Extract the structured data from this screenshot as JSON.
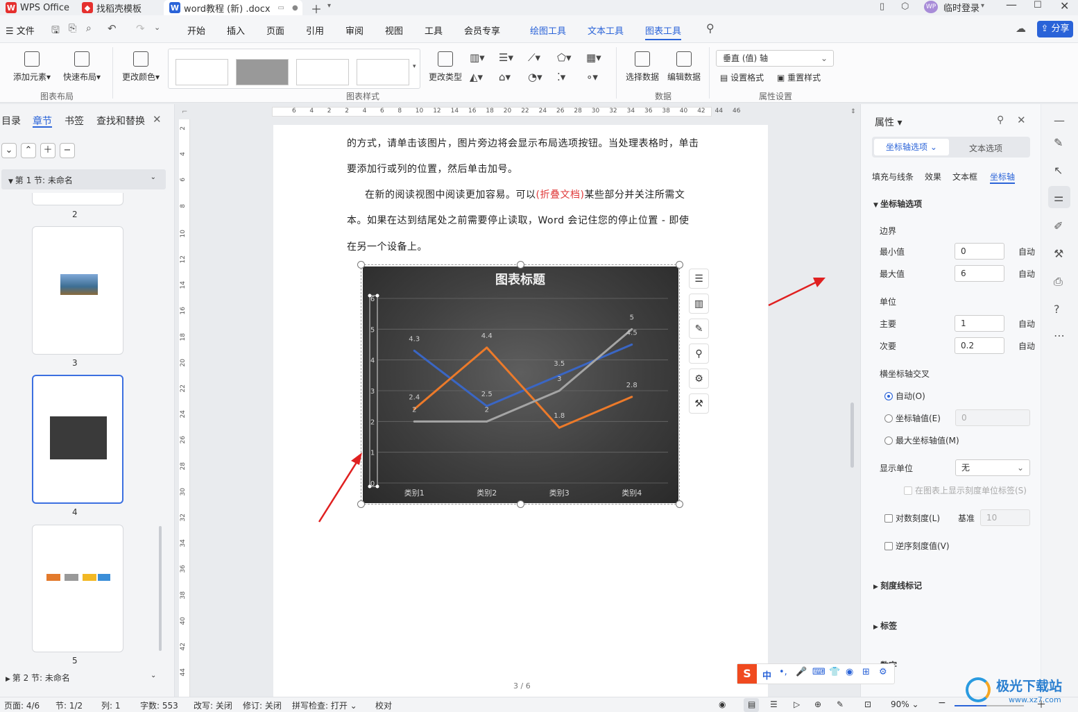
{
  "titlebar": {
    "tabs": [
      {
        "label": "WPS Office",
        "logo": "W",
        "color": "#e5302e"
      },
      {
        "label": "找稻壳模板",
        "logo": "◆",
        "color": "#e5302e"
      },
      {
        "label": "word教程 (新) .docx",
        "logo": "W",
        "color": "#2a63d8"
      }
    ],
    "user": "临时登录"
  },
  "menubar": {
    "file": "文件",
    "items": [
      "开始",
      "插入",
      "页面",
      "引用",
      "审阅",
      "视图",
      "工具",
      "会员专享"
    ],
    "tool_tabs": [
      "绘图工具",
      "文本工具",
      "图表工具"
    ],
    "share": "分享"
  },
  "ribbon": {
    "add_element": "添加元素",
    "quick_layout": "快速布局",
    "group_layout": "图表布局",
    "change_color": "更改颜色",
    "group_style": "图表样式",
    "change_type": "更改类型",
    "select_data": "选择数据",
    "edit_data": "编辑数据",
    "group_data": "数据",
    "axis_dropdown": "垂直 (值) 轴",
    "set_format": "设置格式",
    "reset_style": "重置样式",
    "group_props": "属性设置"
  },
  "leftpane": {
    "tabs": [
      "目录",
      "章节",
      "书签",
      "查找和替换"
    ],
    "section1": "第 1 节: 未命名",
    "section2": "第 2 节: 未命名",
    "pages": [
      "2",
      "3",
      "4",
      "5"
    ]
  },
  "ruler": {
    "h_ticks": [
      "6",
      "4",
      "2",
      "2",
      "4",
      "6",
      "8",
      "10",
      "12",
      "14",
      "16",
      "18",
      "20",
      "22",
      "24",
      "26",
      "28",
      "30",
      "32",
      "34",
      "36",
      "38",
      "40",
      "42",
      "44",
      "46"
    ],
    "v_ticks": [
      "2",
      "4",
      "6",
      "8",
      "10",
      "12",
      "14",
      "16",
      "18",
      "20",
      "22",
      "24",
      "26",
      "28",
      "30",
      "32",
      "34",
      "36",
      "38",
      "40",
      "42",
      "44"
    ]
  },
  "document": {
    "line1": "的方式，请单击该图片，图片旁边将会显示布局选项按钮。当处理表格时，单击",
    "line2": "要添加行或列的位置，然后单击加号。",
    "line3_pre": "在新的阅读视图中阅读更加容易。可以",
    "line3_red": "(折叠文档)",
    "line3_post": "某些部分并关注所需文",
    "line4": "本。如果在达到结尾处之前需要停止读取，Word 会记住您的停止位置 - 即使",
    "line5": "在另一个设备上。",
    "page_indicator": "3 / 6"
  },
  "chart_data": {
    "type": "line",
    "title": "图表标题",
    "categories": [
      "类别1",
      "类别2",
      "类别3",
      "类别4"
    ],
    "ylim": [
      0,
      6
    ],
    "y_ticks": [
      "0",
      "1",
      "2",
      "3",
      "4",
      "5",
      "6"
    ],
    "series": [
      {
        "values": [
          4.3,
          2.5,
          3.5,
          4.5
        ],
        "color": "#3a66c4",
        "labels": [
          "4.3",
          "2.5",
          "3.5",
          "4.5"
        ]
      },
      {
        "values": [
          2.4,
          4.4,
          1.8,
          2.8
        ],
        "color": "#ec7a2a",
        "labels": [
          "2.4",
          "4.4",
          "1.8",
          "2.8"
        ]
      },
      {
        "values": [
          2,
          2,
          3,
          5
        ],
        "color": "#a5a5a5",
        "labels": [
          "2",
          "2",
          "3",
          "5"
        ]
      }
    ],
    "grid": true,
    "legend": "none"
  },
  "rightpanel": {
    "title": "属性",
    "tab_axis": "坐标轴选项",
    "tab_text": "文本选项",
    "subtabs": [
      "填充与线条",
      "效果",
      "文本框",
      "坐标轴"
    ],
    "section_axis": "坐标轴选项",
    "bounds": "边界",
    "min_label": "最小值",
    "min_value": "0",
    "max_label": "最大值",
    "max_value": "6",
    "auto": "自动",
    "units": "单位",
    "major_label": "主要",
    "major_value": "1",
    "minor_label": "次要",
    "minor_value": "0.2",
    "cross": "横坐标轴交叉",
    "opt_auto": "自动(O)",
    "opt_value": "坐标轴值(E)",
    "opt_value_input": "0",
    "opt_max": "最大坐标轴值(M)",
    "display_unit": "显示单位",
    "display_unit_value": "无",
    "show_unit_label": "在图表上显示刻度单位标签(S)",
    "log_scale": "对数刻度(L)",
    "base_label": "基准",
    "base_value": "10",
    "reverse": "逆序刻度值(V)",
    "tick_marks": "刻度线标记",
    "labels": "标签",
    "number": "数字"
  },
  "statusbar": {
    "page": "页面: 4/6",
    "section": "节: 1/2",
    "col": "列: 1",
    "words": "字数: 553",
    "rewrite": "改写: 关闭",
    "revise": "修订: 关闭",
    "spell": "拼写检查: 打开",
    "proof": "校对",
    "zoom": "90%"
  },
  "ime": {
    "mode": "中"
  },
  "watermark": "极光下载站",
  "watermark_url": "www.xz7.com"
}
